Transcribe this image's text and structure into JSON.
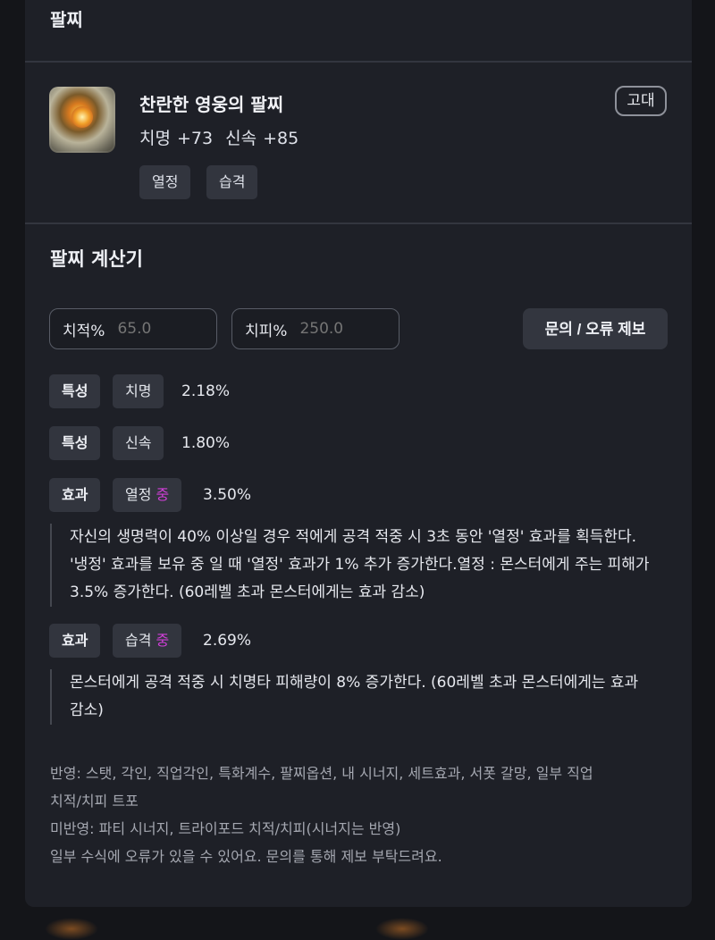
{
  "header": {
    "title": "팔찌"
  },
  "item": {
    "name": "찬란한 영웅의 팔찌",
    "stats": [
      "치명 +73",
      "신속 +85"
    ],
    "tags": [
      "열정",
      "습격"
    ],
    "grade": "고대",
    "icon": "bracelet-icon"
  },
  "calculator": {
    "title": "팔찌 계산기",
    "inputs": [
      {
        "label": "치적%",
        "placeholder": "65.0"
      },
      {
        "label": "치피%",
        "placeholder": "250.0"
      }
    ],
    "report_button": "문의 / 오류 제보",
    "rows": [
      {
        "type": "특성",
        "name": "치명",
        "level": "",
        "value": "2.18%"
      },
      {
        "type": "특성",
        "name": "신속",
        "level": "",
        "value": "1.80%"
      },
      {
        "type": "효과",
        "name": "열정",
        "level": "중",
        "value": "3.50%"
      },
      {
        "type": "효과",
        "name": "습격",
        "level": "중",
        "value": "2.69%"
      }
    ],
    "descriptions": [
      [
        "자신의 생명력이 40% 이상일 경우 적에게 공격 적중 시 3초 동안 '열정' 효과를 획득한다.",
        "'냉정' 효과를 보유 중 일 때 '열정' 효과가 1% 추가 증가한다.열정 : 몬스터에게 주는 피해가",
        "3.5% 증가한다. (60레벨 초과 몬스터에게는 효과 감소)"
      ],
      [
        "몬스터에게 공격 적중 시 치명타 피해량이 8% 증가한다. (60레벨 초과 몬스터에게는 효과",
        "감소)"
      ]
    ],
    "notes": [
      "반영: 스탯, 각인, 직업각인, 특화계수, 팔찌옵션, 내 시너지, 세트효과, 서폿 갈망, 일부 직업",
      "치적/치피 트포",
      "미반영: 파티 시너지, 트라이포드 치적/치피(시너지는 반영)",
      "일부 수식에 오류가 있을 수 있어요. 문의를 통해 제보 부탁드려요."
    ]
  },
  "colors": {
    "level_accent": "#d13fd8",
    "card_bg": "#1e2027",
    "page_bg": "#141519"
  }
}
